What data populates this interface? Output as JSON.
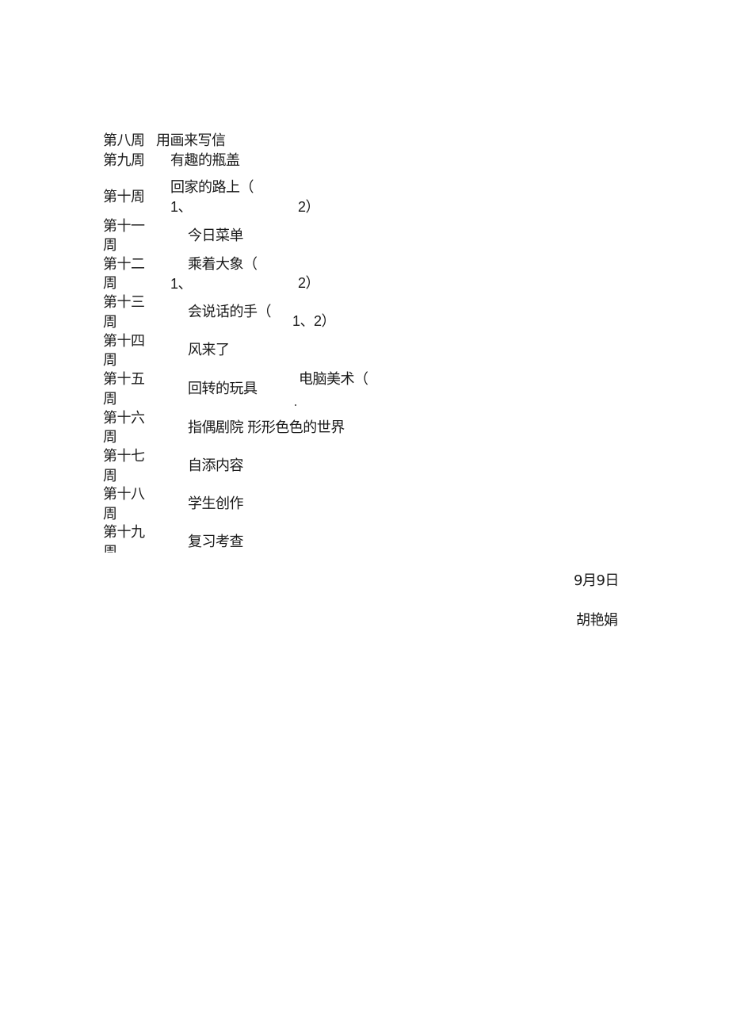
{
  "schedule": [
    {
      "week": "第八周",
      "lesson": "用画来写信"
    },
    {
      "week": "第九周",
      "lesson": "有趣的瓶盖"
    },
    {
      "week": "第十周",
      "lesson": "回家的路上（",
      "extra_a": "1、",
      "extra_b": "2）"
    },
    {
      "week_line1": "第十一",
      "week_line2": "周",
      "lesson": "今日菜单"
    },
    {
      "week_line1": "第十二",
      "week_line2": "周",
      "lesson": "乘着大象（",
      "extra_a": "1、",
      "extra_b": "2）"
    },
    {
      "week_line1": "第十三",
      "week_line2": "周",
      "lesson": "会说话的手（",
      "extra_b": "1、2）"
    },
    {
      "week_line1": "第十四",
      "week_line2": "周",
      "lesson": "风来了"
    },
    {
      "week_line1": "第十五",
      "week_line2": "周",
      "lesson": "回转的玩具",
      "extra_b": "电脑美术（",
      "extra_c": "."
    },
    {
      "week_line1": "第十六",
      "week_line2": "周",
      "lesson": "指偶剧院  形形色色的世界"
    },
    {
      "week_line1": "第十七",
      "week_line2": "周",
      "lesson": "自添内容"
    },
    {
      "week_line1": "第十八",
      "week_line2": "周",
      "lesson": "学生创作"
    },
    {
      "week_line1": "第十九",
      "week_line2": "周",
      "lesson": "复习考查"
    }
  ],
  "footer": {
    "date": "9月9日",
    "author": "胡艳娟"
  }
}
